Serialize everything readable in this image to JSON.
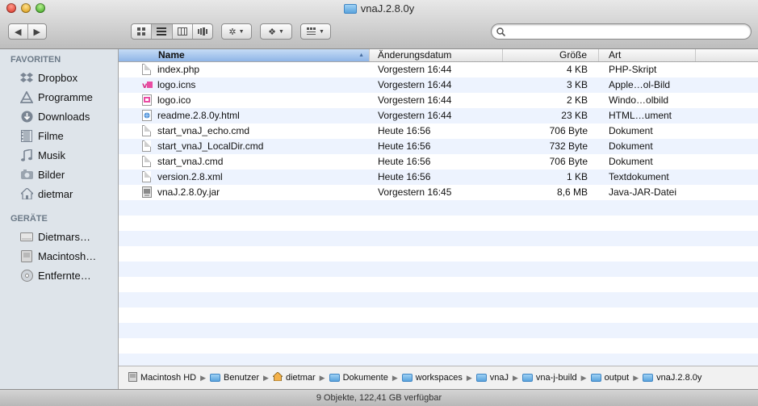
{
  "window": {
    "title": "vnaJ.2.8.0y"
  },
  "search": {
    "placeholder": ""
  },
  "sidebar": {
    "sections": [
      {
        "header": "FAVORITEN",
        "items": [
          {
            "label": "Dropbox",
            "icon": "dropbox-icon"
          },
          {
            "label": "Programme",
            "icon": "applications-icon"
          },
          {
            "label": "Downloads",
            "icon": "downloads-icon"
          },
          {
            "label": "Filme",
            "icon": "movies-icon"
          },
          {
            "label": "Musik",
            "icon": "music-icon"
          },
          {
            "label": "Bilder",
            "icon": "pictures-icon"
          },
          {
            "label": "dietmar",
            "icon": "home-icon"
          }
        ]
      },
      {
        "header": "GERÄTE",
        "items": [
          {
            "label": "Dietmars…",
            "icon": "drive-icon"
          },
          {
            "label": "Macintosh…",
            "icon": "hard-disk-icon"
          },
          {
            "label": "Entfernte…",
            "icon": "remote-disc-icon"
          }
        ]
      }
    ]
  },
  "columns": {
    "name": "Name",
    "date": "Änderungsdatum",
    "size": "Größe",
    "kind": "Art"
  },
  "files": [
    {
      "name": "index.php",
      "date": "Vorgestern 16:44",
      "size": "4 KB",
      "kind": "PHP-Skript",
      "icon": "document-icon"
    },
    {
      "name": "logo.icns",
      "date": "Vorgestern 16:44",
      "size": "3 KB",
      "kind": "Apple…ol-Bild",
      "icon": "icns-icon"
    },
    {
      "name": "logo.ico",
      "date": "Vorgestern 16:44",
      "size": "2 KB",
      "kind": "Windo…olbild",
      "icon": "ico-icon"
    },
    {
      "name": "readme.2.8.0y.html",
      "date": "Vorgestern 16:44",
      "size": "23 KB",
      "kind": "HTML…ument",
      "icon": "html-icon"
    },
    {
      "name": "start_vnaJ_echo.cmd",
      "date": "Heute 16:56",
      "size": "706 Byte",
      "kind": "Dokument",
      "icon": "document-icon"
    },
    {
      "name": "start_vnaJ_LocalDir.cmd",
      "date": "Heute 16:56",
      "size": "732 Byte",
      "kind": "Dokument",
      "icon": "document-icon"
    },
    {
      "name": "start_vnaJ.cmd",
      "date": "Heute 16:56",
      "size": "706 Byte",
      "kind": "Dokument",
      "icon": "document-icon"
    },
    {
      "name": "version.2.8.xml",
      "date": "Heute 16:56",
      "size": "1 KB",
      "kind": "Textdokument",
      "icon": "document-icon"
    },
    {
      "name": "vnaJ.2.8.0y.jar",
      "date": "Vorgestern 16:45",
      "size": "8,6 MB",
      "kind": "Java-JAR-Datei",
      "icon": "jar-icon"
    }
  ],
  "path": [
    {
      "label": "Macintosh HD",
      "icon": "hard-disk-icon"
    },
    {
      "label": "Benutzer",
      "icon": "folder-icon"
    },
    {
      "label": "dietmar",
      "icon": "home-icon"
    },
    {
      "label": "Dokumente",
      "icon": "folder-icon"
    },
    {
      "label": "workspaces",
      "icon": "folder-icon"
    },
    {
      "label": "vnaJ",
      "icon": "folder-icon"
    },
    {
      "label": "vna-j-build",
      "icon": "folder-icon"
    },
    {
      "label": "output",
      "icon": "folder-icon"
    },
    {
      "label": "vnaJ.2.8.0y",
      "icon": "folder-icon"
    }
  ],
  "status": {
    "text": "9 Objekte, 122,41 GB verfügbar"
  },
  "colors": {
    "selection_header": "#8fb5e7",
    "sidebar_bg": "#dee4ea",
    "row_alt": "#edf3fe"
  }
}
